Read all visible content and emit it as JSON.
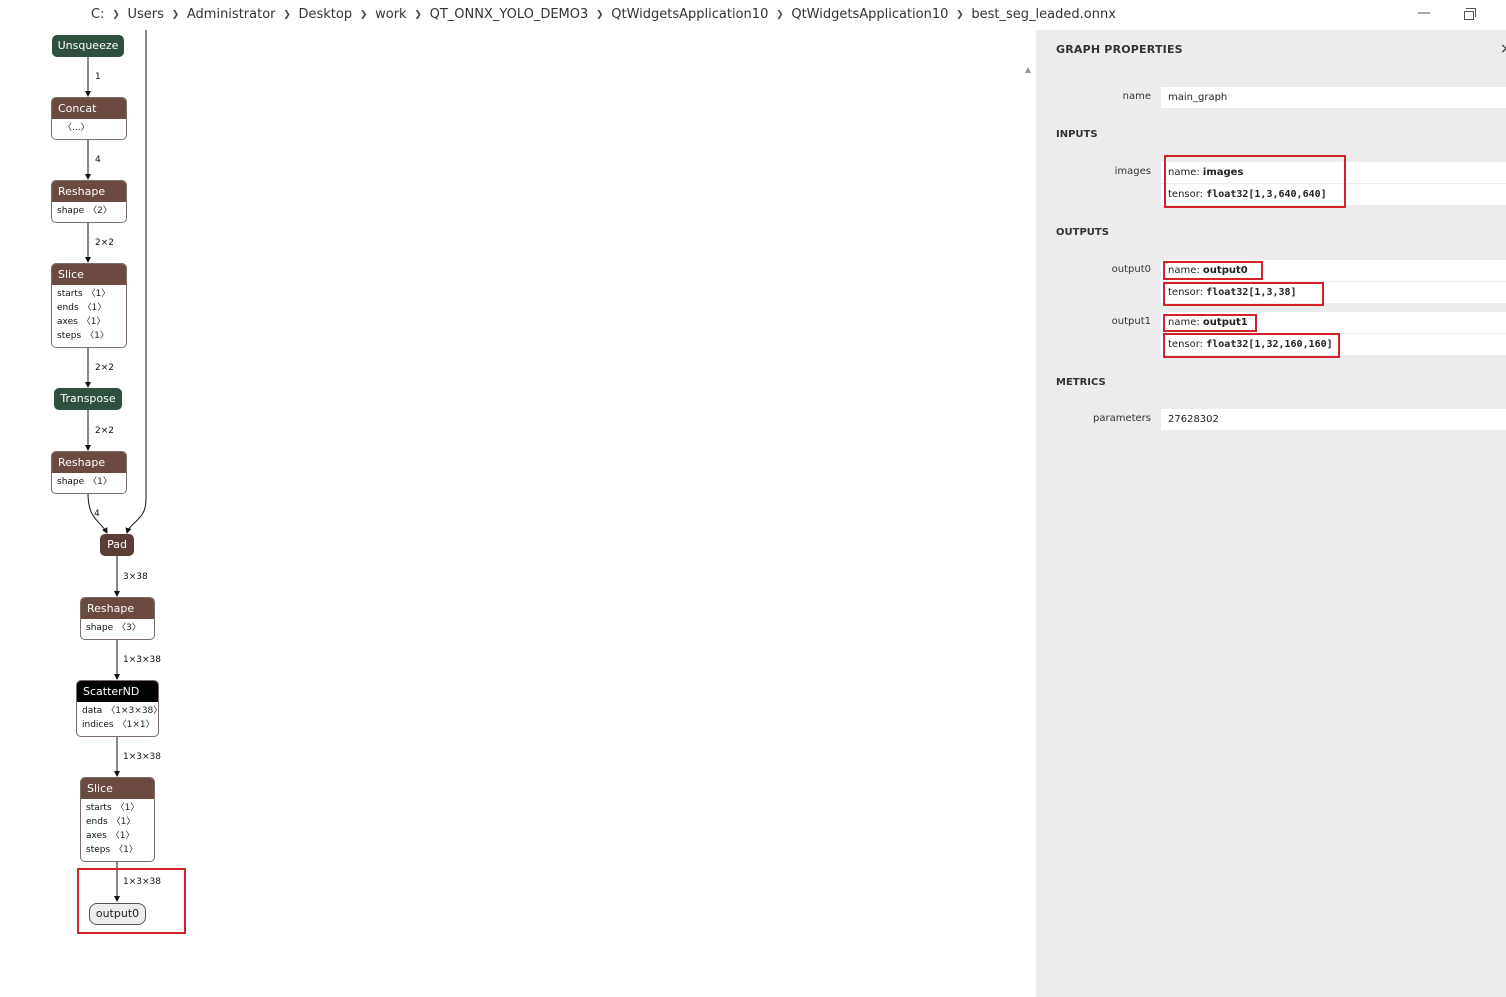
{
  "breadcrumb": [
    "C:",
    "Users",
    "Administrator",
    "Desktop",
    "work",
    "QT_ONNX_YOLO_DEMO3",
    "QtWidgetsApplication10",
    "QtWidgetsApplication10",
    "best_seg_leaded.onnx"
  ],
  "window": {
    "minimize": "—",
    "restore": "restore-icon"
  },
  "graph": {
    "nodes": {
      "unsqueeze": "Unsqueeze",
      "concat": {
        "title": "Concat",
        "attr": "〈...〉"
      },
      "reshape1": {
        "title": "Reshape",
        "attr_name": "shape",
        "attr_val": "〈2〉"
      },
      "slice1": {
        "title": "Slice",
        "attrs": [
          {
            "name": "starts",
            "val": "〈1〉"
          },
          {
            "name": "ends",
            "val": "〈1〉"
          },
          {
            "name": "axes",
            "val": "〈1〉"
          },
          {
            "name": "steps",
            "val": "〈1〉"
          }
        ]
      },
      "transpose": "Transpose",
      "reshape2": {
        "title": "Reshape",
        "attr_name": "shape",
        "attr_val": "〈1〉"
      },
      "pad": "Pad",
      "reshape3": {
        "title": "Reshape",
        "attr_name": "shape",
        "attr_val": "〈3〉"
      },
      "scatternd": {
        "title": "ScatterND",
        "attrs": [
          {
            "name": "data",
            "val": "〈1×3×38〉"
          },
          {
            "name": "indices",
            "val": "〈1×1〉"
          }
        ]
      },
      "slice2": {
        "title": "Slice",
        "attrs": [
          {
            "name": "starts",
            "val": "〈1〉"
          },
          {
            "name": "ends",
            "val": "〈1〉"
          },
          {
            "name": "axes",
            "val": "〈1〉"
          },
          {
            "name": "steps",
            "val": "〈1〉"
          }
        ]
      },
      "output": "output0"
    },
    "edge_labels": {
      "e1": "1",
      "e2": "4",
      "e3": "2×2",
      "e4": "2×2",
      "e5": "2×2",
      "e6": "4",
      "e7": "3×38",
      "e8": "1×3×38",
      "e9": "1×3×38",
      "e10": "1×3×38"
    }
  },
  "sidebar": {
    "title": "GRAPH PROPERTIES",
    "close": "×",
    "name_label": "name",
    "name_value": "main_graph",
    "inputs_head": "INPUTS",
    "images_label": "images",
    "images_name_prefix": "name: ",
    "images_name": "images",
    "images_tensor_prefix": "tensor: ",
    "images_tensor": "float32[1,3,640,640]",
    "outputs_head": "OUTPUTS",
    "output0_label": "output0",
    "output0_name_prefix": "name: ",
    "output0_name": "output0",
    "output0_tensor_prefix": "tensor: ",
    "output0_tensor": "float32[1,3,38]",
    "output1_label": "output1",
    "output1_name_prefix": "name: ",
    "output1_name": "output1",
    "output1_tensor_prefix": "tensor: ",
    "output1_tensor": "float32[1,32,160,160]",
    "metrics_head": "METRICS",
    "parameters_label": "parameters",
    "parameters_value": "27628302"
  }
}
